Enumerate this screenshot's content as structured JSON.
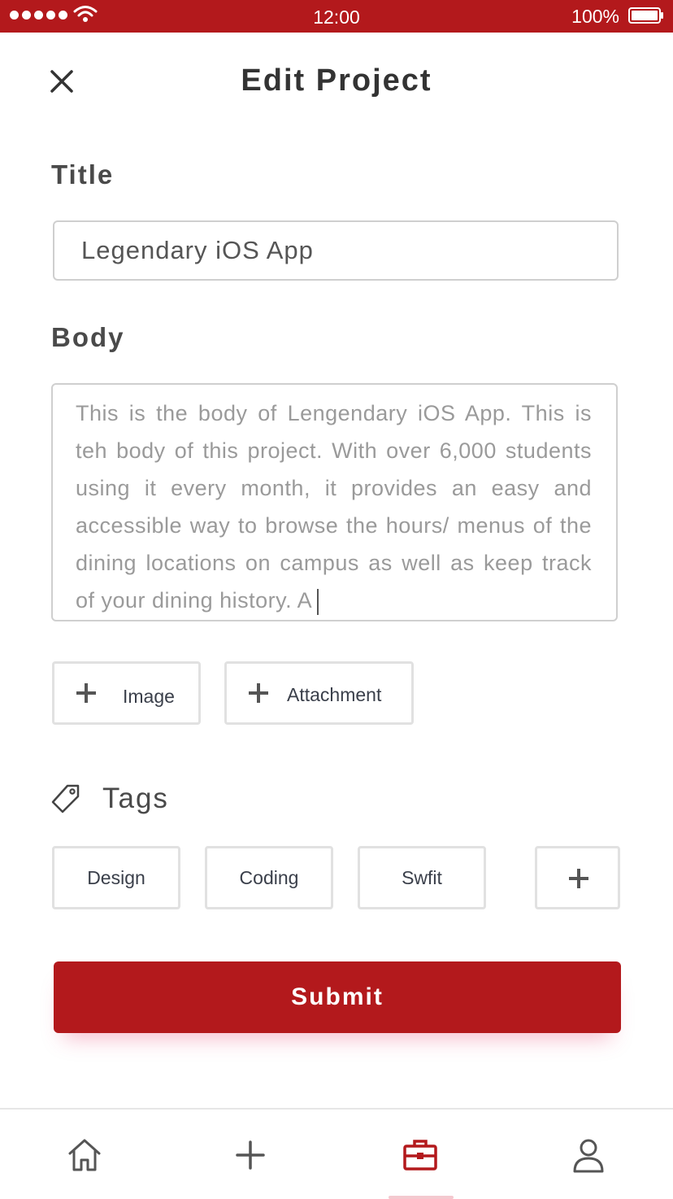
{
  "status_bar": {
    "time": "12:00",
    "battery": "100%"
  },
  "header": {
    "title": "Edit Project",
    "close_icon": "close-icon"
  },
  "form": {
    "title_label": "Title",
    "title_value": "Legendary iOS App",
    "body_label": "Body",
    "body_value": "This is the body of Lengendary iOS App. This is teh body of this project. With over 6,000 students using it every month, it provides an easy and accessible way to browse the hours/ menus of the dining locations on campus as well as keep track of your dining history. A"
  },
  "media": {
    "image_label": "Image",
    "attachment_label": "Attachment"
  },
  "tags": {
    "title": "Tags",
    "items": [
      {
        "label": "Design"
      },
      {
        "label": "Coding"
      },
      {
        "label": "Swfit"
      }
    ]
  },
  "submit_label": "Submit",
  "tab_bar": {
    "items": [
      {
        "icon": "home-icon"
      },
      {
        "icon": "plus-icon"
      },
      {
        "icon": "briefcase-icon"
      },
      {
        "icon": "user-icon"
      }
    ],
    "active_index": 2
  },
  "colors": {
    "accent": "#b3191c",
    "border": "#e1e1e1",
    "text": "#333333",
    "muted": "#9a9a9a"
  }
}
